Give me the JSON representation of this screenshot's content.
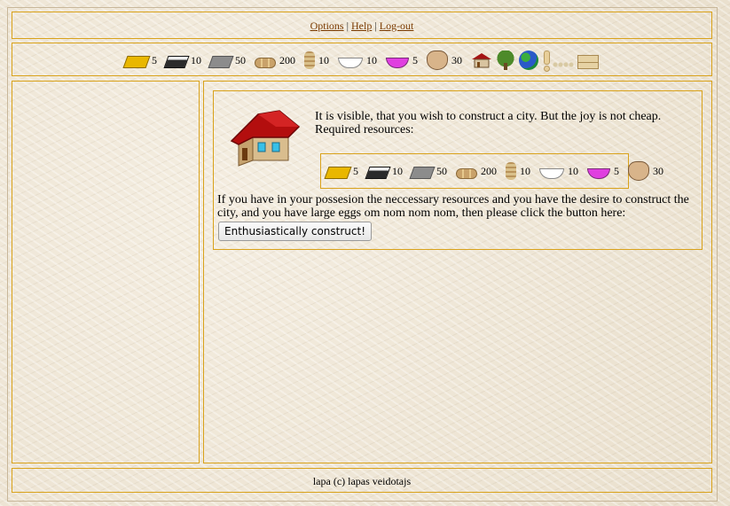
{
  "menu": {
    "options": "Options",
    "help": "Help",
    "logout": "Log-out",
    "separator": "|"
  },
  "resources": [
    {
      "icon": "gold-bar-icon",
      "value": "5"
    },
    {
      "icon": "iron-ingot-icon",
      "value": "10"
    },
    {
      "icon": "stone-block-icon",
      "value": "50"
    },
    {
      "icon": "wood-logs-icon",
      "value": "200"
    },
    {
      "icon": "wheat-sack-icon",
      "value": "10"
    },
    {
      "icon": "milk-bowl-icon",
      "value": "10"
    },
    {
      "icon": "berry-bowl-icon",
      "value": "5"
    },
    {
      "icon": "cat-face-icon",
      "value": "30"
    }
  ],
  "nav_icons": [
    "house-icon",
    "tree-icon",
    "globe-icon",
    "exclamation-icon",
    "ellipsis-icon",
    "envelope-icon"
  ],
  "content": {
    "intro_line1": "It is visible, that you wish to construct a city. But the joy is not cheap.",
    "intro_line2": "Required resources:",
    "description": "If you have in your possesion the neccessary resources and you have the desire to construct the city, and you have large eggs om nom nom nom, then please click the button here:",
    "button_label": "Enthusiastically construct!"
  },
  "required": [
    {
      "icon": "gold-bar-icon",
      "value": "5"
    },
    {
      "icon": "iron-ingot-icon",
      "value": "10"
    },
    {
      "icon": "stone-block-icon",
      "value": "50"
    },
    {
      "icon": "wood-logs-icon",
      "value": "200"
    },
    {
      "icon": "wheat-sack-icon",
      "value": "10"
    },
    {
      "icon": "milk-bowl-icon",
      "value": "10"
    },
    {
      "icon": "berry-bowl-icon",
      "value": "5"
    },
    {
      "icon": "cat-face-icon",
      "value": "30"
    }
  ],
  "footer": {
    "text": "lapa (c) lapas veidotajs"
  }
}
